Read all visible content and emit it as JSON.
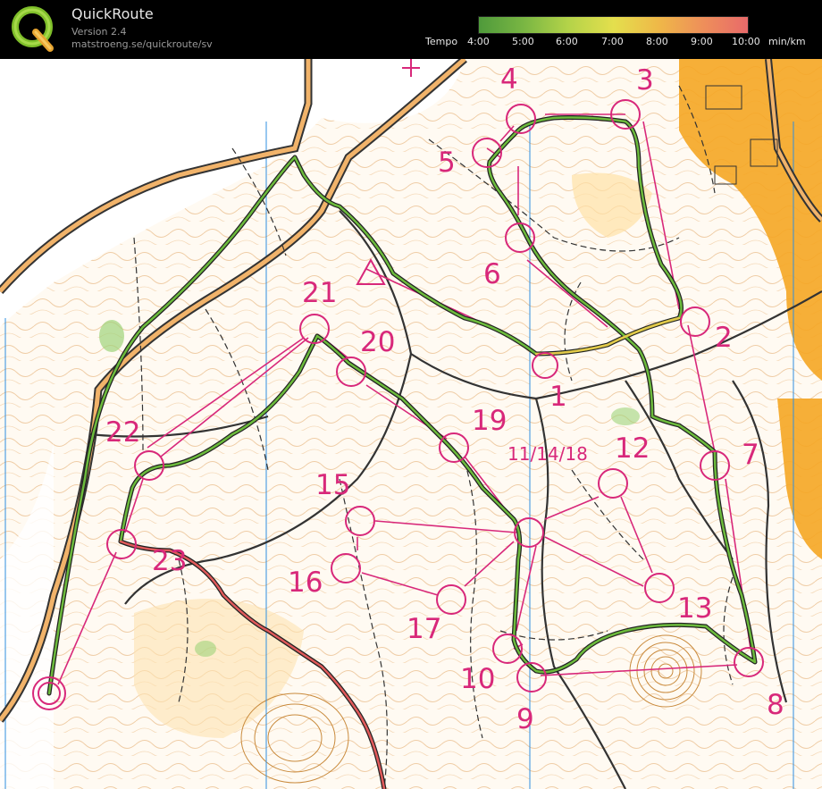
{
  "header": {
    "app_name": "QuickRoute",
    "version": "Version 2.4",
    "url": "matstroeng.se/quickroute/sv",
    "tempo_label": "Tempo",
    "tempo_ticks": [
      "4:00",
      "5:00",
      "6:00",
      "7:00",
      "8:00",
      "9:00",
      "10:00"
    ],
    "tempo_unit": "min/km",
    "tempo_colors": [
      "#4f9a3b",
      "#79b643",
      "#b4d349",
      "#e4df4d",
      "#efb848",
      "#ee8f5a",
      "#e86a6a"
    ]
  },
  "map": {
    "controls": [
      {
        "id": "start",
        "label": ""
      },
      {
        "id": "1",
        "label": "1"
      },
      {
        "id": "2",
        "label": "2"
      },
      {
        "id": "3",
        "label": "3"
      },
      {
        "id": "4",
        "label": "4"
      },
      {
        "id": "5",
        "label": "5"
      },
      {
        "id": "6",
        "label": "6"
      },
      {
        "id": "7",
        "label": "7"
      },
      {
        "id": "8",
        "label": "8"
      },
      {
        "id": "9",
        "label": "9"
      },
      {
        "id": "10",
        "label": "10"
      },
      {
        "id": "11_14_18",
        "label": "11/14/18"
      },
      {
        "id": "12",
        "label": "12"
      },
      {
        "id": "13",
        "label": "13"
      },
      {
        "id": "15",
        "label": "15"
      },
      {
        "id": "16",
        "label": "16"
      },
      {
        "id": "17",
        "label": "17"
      },
      {
        "id": "19",
        "label": "19"
      },
      {
        "id": "20",
        "label": "20"
      },
      {
        "id": "21",
        "label": "21"
      },
      {
        "id": "22",
        "label": "22"
      },
      {
        "id": "23",
        "label": "23"
      }
    ]
  }
}
